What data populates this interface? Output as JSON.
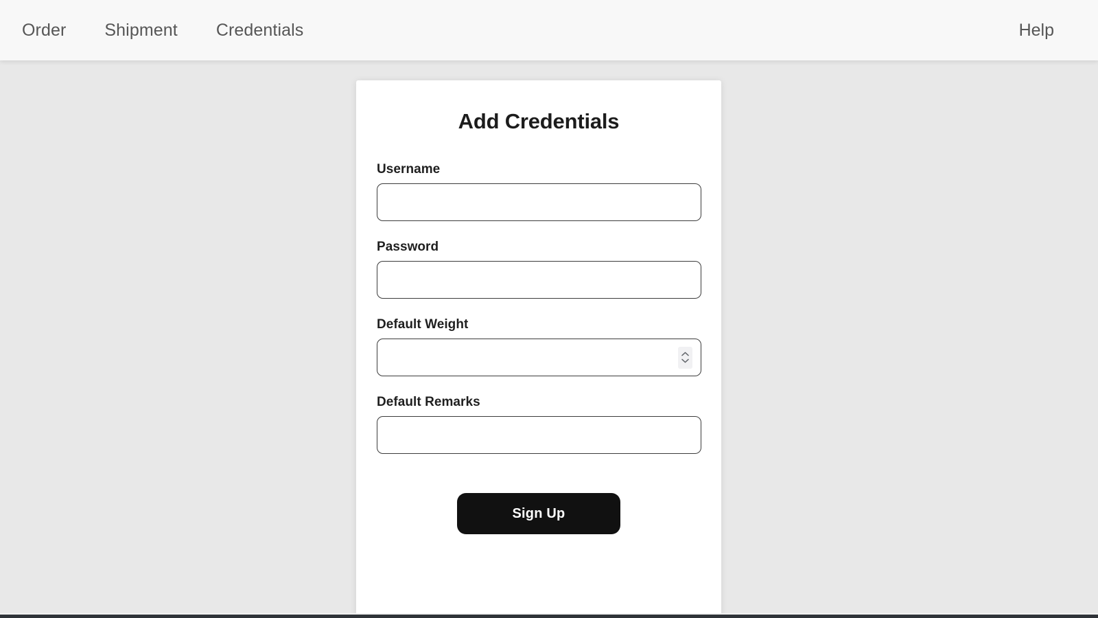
{
  "navbar": {
    "items": [
      {
        "label": "Order",
        "name": "nav-link-order"
      },
      {
        "label": "Shipment",
        "name": "nav-link-shipment"
      },
      {
        "label": "Credentials",
        "name": "nav-link-credentials"
      }
    ],
    "help_label": "Help"
  },
  "card": {
    "title": "Add Credentials",
    "fields": [
      {
        "label": "Username",
        "value": "",
        "placeholder": "",
        "type": "text",
        "has_spinner": false
      },
      {
        "label": "Password",
        "value": "",
        "placeholder": "",
        "type": "password",
        "has_spinner": false
      },
      {
        "label": "Default Weight",
        "value": "",
        "placeholder": "",
        "type": "number",
        "has_spinner": true,
        "spinner_icons": [
          "chevron-up-icon",
          "chevron-down-icon"
        ]
      },
      {
        "label": "Default Remarks",
        "value": "",
        "placeholder": "",
        "type": "text",
        "has_spinner": false
      }
    ],
    "submit_label": "Sign Up"
  },
  "colors": {
    "page_background": "#e8e8e8",
    "navbar_background": "#f8f8f8",
    "card_background": "#ffffff",
    "nav_text": "#565656",
    "title_text": "#1c1c1c",
    "label_text": "#1f1f1f",
    "input_border": "#3b3b3b",
    "button_background": "#111111",
    "button_text": "#ffffff",
    "spinner_background": "#f1f1f3",
    "scrollbar_thumb": "#2f3338"
  }
}
